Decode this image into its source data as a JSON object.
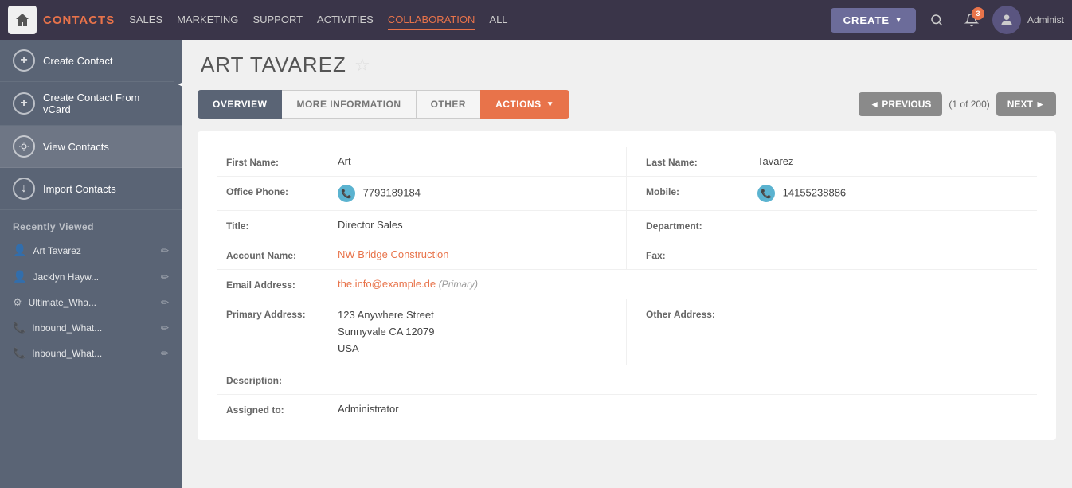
{
  "nav": {
    "brand": "CONTACTS",
    "links": [
      "SALES",
      "MARKETING",
      "SUPPORT",
      "ACTIVITIES",
      "COLLABORATION",
      "ALL"
    ],
    "create_label": "CREATE",
    "admin_label": "Administ",
    "notif_count": "3"
  },
  "sidebar": {
    "actions": [
      {
        "id": "create-contact",
        "label": "Create Contact",
        "icon": "+"
      },
      {
        "id": "create-from-vcard",
        "label": "Create Contact From vCard",
        "icon": "+"
      },
      {
        "id": "view-contacts",
        "label": "View Contacts",
        "icon": "👁"
      },
      {
        "id": "import-contacts",
        "label": "Import Contacts",
        "icon": "↓"
      }
    ],
    "recently_viewed_title": "Recently Viewed",
    "recent_items": [
      {
        "name": "Art Tavarez",
        "type": "person"
      },
      {
        "name": "Jacklyn Hayw...",
        "type": "person"
      },
      {
        "name": "Ultimate_Wha...",
        "type": "other"
      },
      {
        "name": "Inbound_What...",
        "type": "phone"
      },
      {
        "name": "Inbound_What...",
        "type": "phone"
      }
    ]
  },
  "contact": {
    "name": "ART TAVAREZ",
    "star": "☆",
    "first_name": "Art",
    "last_name": "Tavarez",
    "office_phone": "7793189184",
    "mobile": "14155238886",
    "title": "Director Sales",
    "department": "",
    "account_name": "NW Bridge Construction",
    "fax": "",
    "email": "the.info@example.de",
    "email_type": "(Primary)",
    "primary_address_line1": "123 Anywhere Street",
    "primary_address_line2": "Sunnyvale CA  12079",
    "primary_address_line3": "USA",
    "other_address": "",
    "description": "",
    "assigned_to": "Administrator"
  },
  "tabs": {
    "items": [
      "OVERVIEW",
      "MORE INFORMATION",
      "OTHER",
      "ACTIONS"
    ],
    "active": "OVERVIEW"
  },
  "pagination": {
    "prev": "◄ PREVIOUS",
    "count": "(1 of 200)",
    "next": "NEXT ►"
  },
  "labels": {
    "first_name": "First Name:",
    "last_name": "Last Name:",
    "office_phone": "Office Phone:",
    "mobile": "Mobile:",
    "title": "Title:",
    "department": "Department:",
    "account_name": "Account Name:",
    "fax": "Fax:",
    "email_address": "Email Address:",
    "primary_address": "Primary Address:",
    "other_address": "Other Address:",
    "description": "Description:",
    "assigned_to": "Assigned to:"
  }
}
